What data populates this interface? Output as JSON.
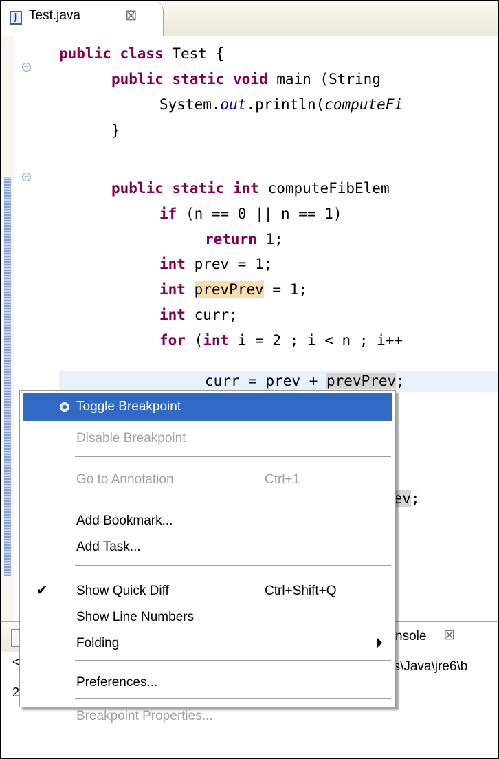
{
  "editor_tab": {
    "label": "Test.java",
    "icon": "java-file-icon"
  },
  "code": {
    "l1": [
      "public class",
      " Test {"
    ],
    "l2": [
      "public static void",
      " main (String"
    ],
    "l3": [
      "System.",
      "out",
      ".println(",
      "computeFi"
    ],
    "l4": "}",
    "l6": [
      "public static int",
      " computeFibElem"
    ],
    "l7": [
      "if",
      " (n == 0 || n == 1)"
    ],
    "l8": [
      "return",
      " 1;"
    ],
    "l9": [
      "int",
      " prev = 1;"
    ],
    "l10": [
      "int",
      " ",
      "prevPrev",
      " = 1;"
    ],
    "l11": [
      "int",
      " curr;"
    ],
    "l12": [
      "for",
      " (",
      "int",
      " i = 2 ; i < n ; i++"
    ],
    "l13": [
      "curr = prev + ",
      "prevPrev",
      ";"
    ],
    "l16": [
      "rev",
      ";"
    ]
  },
  "context_menu": {
    "items": [
      {
        "label": "Toggle Breakpoint",
        "state": "selected"
      },
      {
        "label": "Disable Breakpoint",
        "state": "disabled"
      },
      {
        "label": "Go to Annotation",
        "accelerator": "Ctrl+1",
        "state": "disabled"
      },
      {
        "label": "Add Bookmark..."
      },
      {
        "label": "Add Task..."
      },
      {
        "label": "Show Quick Diff",
        "accelerator": "Ctrl+Shift+Q",
        "checked": true
      },
      {
        "label": "Show Line Numbers"
      },
      {
        "label": "Folding",
        "submenu": true
      },
      {
        "label": "Preferences..."
      },
      {
        "label": "Breakpoint Properties...",
        "state": "disabled"
      }
    ]
  },
  "console": {
    "tab_label": "nsole",
    "path_text": "es\\Java\\jre6\\b",
    "left_fragments": [
      "<",
      "2"
    ]
  },
  "colors": {
    "selection": "#316ac5",
    "keyword": "#7f0055",
    "field": "#0000c0",
    "occurrence": "#f7ddb0"
  }
}
